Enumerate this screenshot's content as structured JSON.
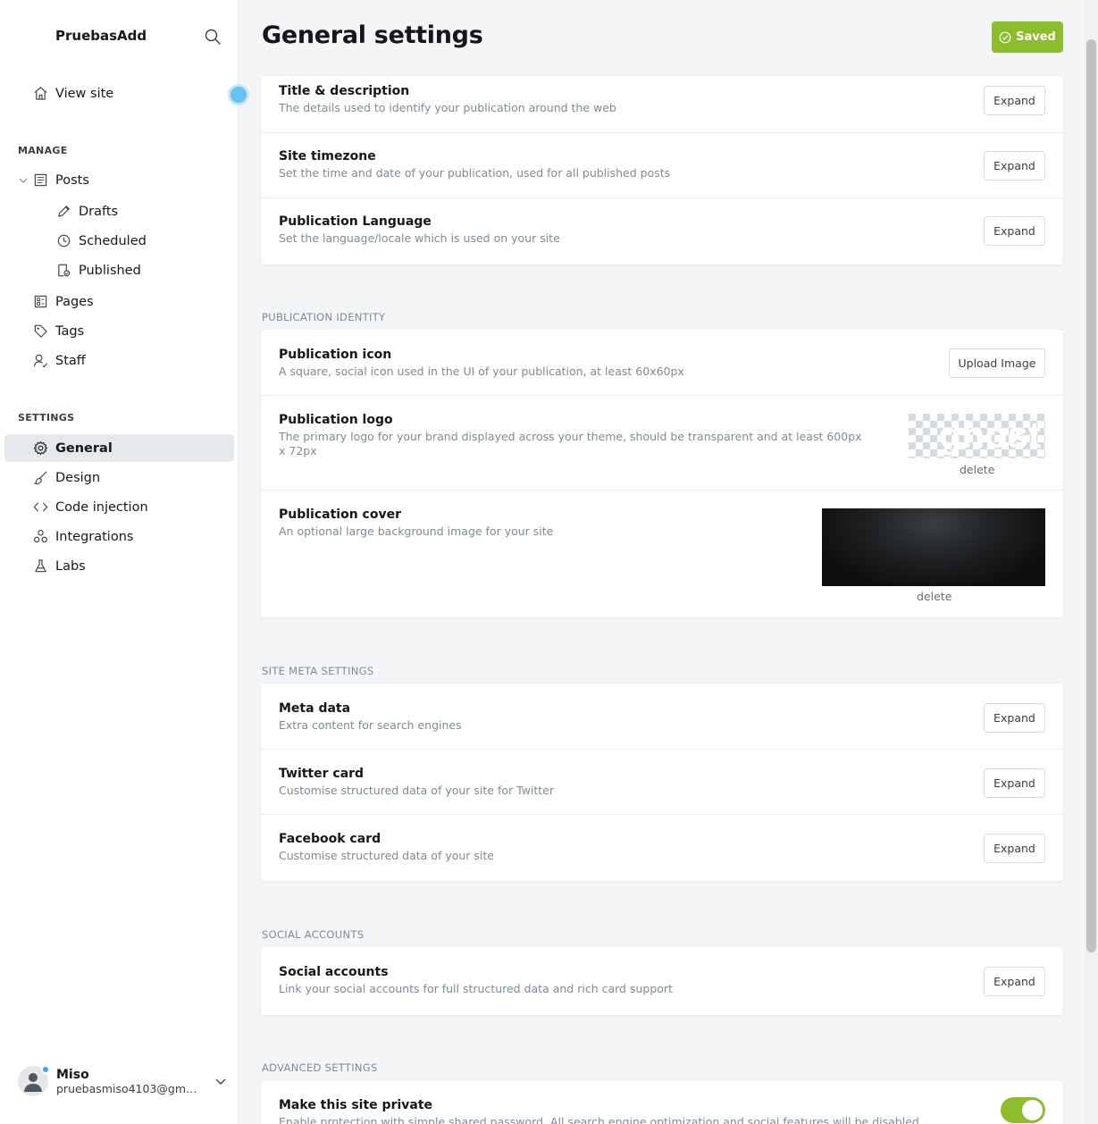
{
  "sidebar": {
    "brand": "PruebasAdd",
    "view_site": "View site",
    "manage_title": "MANAGE",
    "posts": "Posts",
    "drafts": "Drafts",
    "scheduled": "Scheduled",
    "published": "Published",
    "pages": "Pages",
    "tags": "Tags",
    "staff": "Staff",
    "settings_title": "SETTINGS",
    "general": "General",
    "design": "Design",
    "code_injection": "Code injection",
    "integrations": "Integrations",
    "labs": "Labs",
    "user_name": "Miso",
    "user_email": "pruebasmiso4103@gmai..."
  },
  "header": {
    "title": "General settings",
    "saved_label": "Saved"
  },
  "sections": {
    "basic": {
      "title_desc": {
        "title": "Title & description",
        "desc": "The details used to identify your publication around the web",
        "button": "Expand"
      },
      "timezone": {
        "title": "Site timezone",
        "desc": "Set the time and date of your publication, used for all published posts",
        "button": "Expand"
      },
      "language": {
        "title": "Publication Language",
        "desc": "Set the language/locale which is used on your site",
        "button": "Expand"
      }
    },
    "identity": {
      "group_title": "PUBLICATION IDENTITY",
      "icon": {
        "title": "Publication icon",
        "desc": "A square, social icon used in the UI of your publication, at least 60x60px",
        "button": "Upload Image"
      },
      "logo": {
        "title": "Publication logo",
        "desc": "The primary logo for your brand displayed across your theme, should be transparent and at least 600px x 72px",
        "image_text": "ghost",
        "delete": "delete"
      },
      "cover": {
        "title": "Publication cover",
        "desc": "An optional large background image for your site",
        "delete": "delete"
      }
    },
    "meta": {
      "group_title": "SITE META SETTINGS",
      "meta_data": {
        "title": "Meta data",
        "desc": "Extra content for search engines",
        "button": "Expand"
      },
      "twitter": {
        "title": "Twitter card",
        "desc": "Customise structured data of your site for Twitter",
        "button": "Expand"
      },
      "facebook": {
        "title": "Facebook card",
        "desc": "Customise structured data of your site",
        "button": "Expand"
      }
    },
    "social": {
      "group_title": "SOCIAL ACCOUNTS",
      "accounts": {
        "title": "Social accounts",
        "desc": "Link your social accounts for full structured data and rich card support",
        "button": "Expand"
      }
    },
    "advanced": {
      "group_title": "ADVANCED SETTINGS",
      "private": {
        "title": "Make this site private",
        "desc": "Enable protection with simple shared password. All search engine optimization and social features will be disabled.",
        "enabled": true
      }
    }
  },
  "colors": {
    "accent": "#8dbd2c",
    "active_nav": "#e5e9ee",
    "muted_text": "#7c8b9a"
  }
}
